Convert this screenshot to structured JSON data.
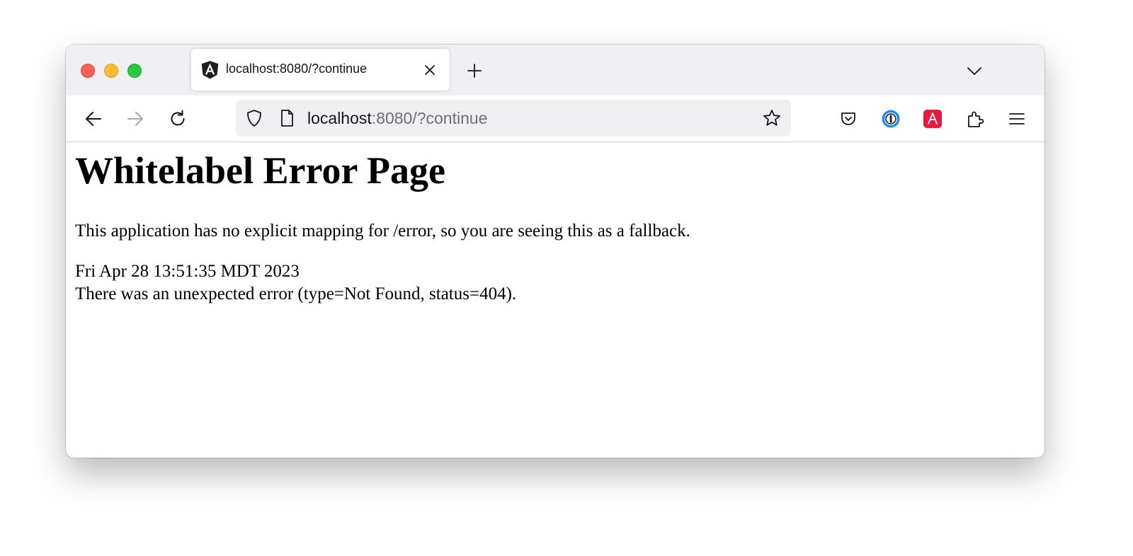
{
  "browser": {
    "tab": {
      "title": "localhost:8080/?continue",
      "favicon": "angular-logo-icon"
    },
    "url": {
      "host": "localhost",
      "rest": ":8080/?continue"
    },
    "toolbar_icons": [
      "back-arrow-icon",
      "forward-arrow-icon",
      "reload-icon",
      "shield-icon",
      "page-icon",
      "bookmark-star-icon",
      "pocket-icon",
      "1password-icon",
      "adobe-acrobat-icon",
      "extensions-icon",
      "menu-icon"
    ],
    "colors": {
      "chrome_bg": "#f0f0f4",
      "traffic_red": "#ff5f57",
      "traffic_yellow": "#febc2e",
      "traffic_green": "#28c840",
      "onepassword_blue": "#1a8cff",
      "acrobat_red": "#e8193c"
    }
  },
  "page": {
    "heading": "Whitelabel Error Page",
    "message": "This application has no explicit mapping for /error, so you are seeing this as a fallback.",
    "timestamp": "Fri Apr 28 13:51:35 MDT 2023",
    "error": "There was an unexpected error (type=Not Found, status=404)."
  }
}
